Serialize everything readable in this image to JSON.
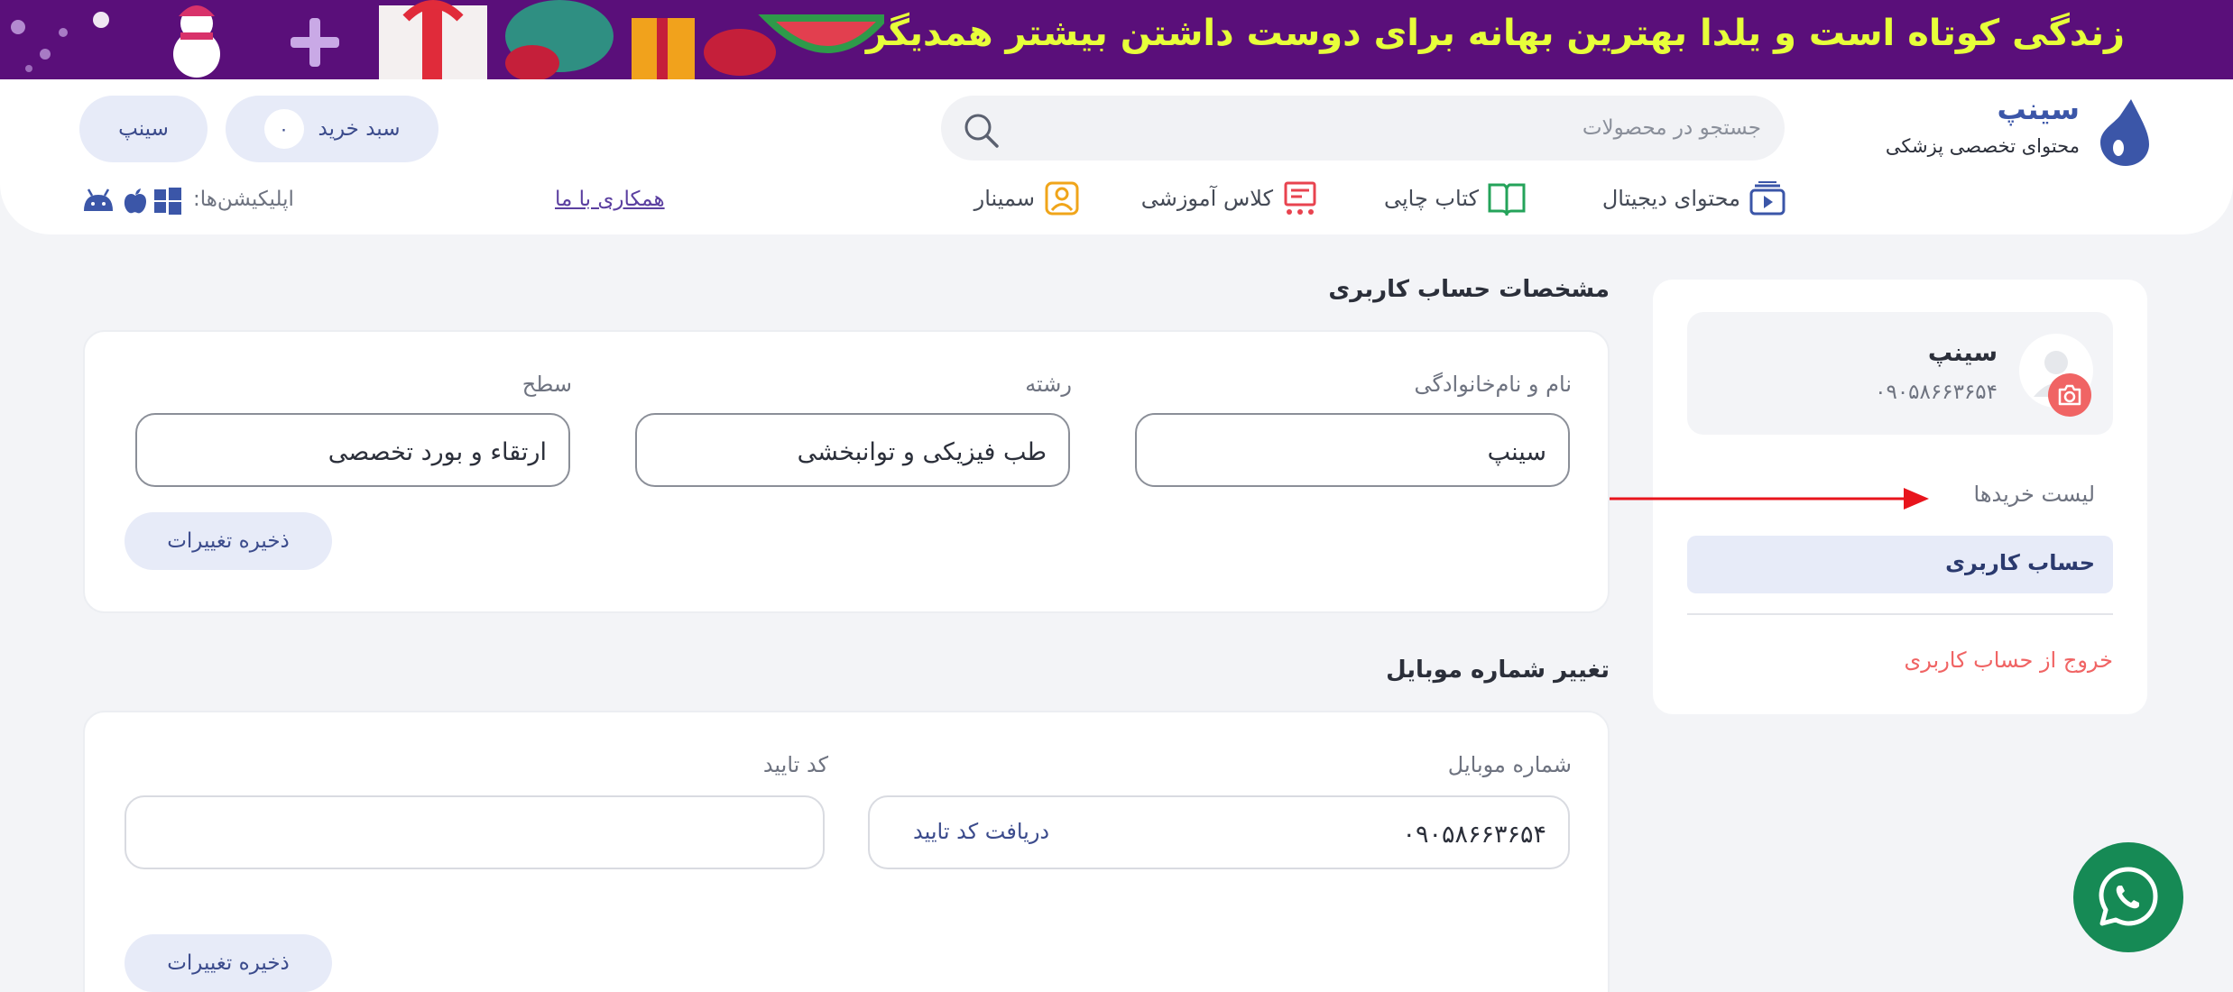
{
  "banner": {
    "text": "زندگی کوتاه است و یلدا بهترین بهانه برای دوست داشتن بیشتر همدیگر"
  },
  "header": {
    "brand_name": "سینپ",
    "brand_subtitle": "محتوای تخصصی پزشکی",
    "search_placeholder": "جستجو در محصولات",
    "cart_label": "سبد خرید",
    "cart_count": "۰",
    "user_label": "سینپ",
    "nav": [
      {
        "label": "محتوای دیجیتال",
        "icon": "digital-content-icon"
      },
      {
        "label": "کتاب چاپی",
        "icon": "book-icon"
      },
      {
        "label": "کلاس آموزشی",
        "icon": "class-icon"
      },
      {
        "label": "سمینار",
        "icon": "seminar-icon"
      }
    ],
    "cooperate_link": "همکاری با ما",
    "apps_label": "اپلیکیشن‌ها:",
    "app_icons": [
      "windows-icon",
      "apple-icon",
      "android-icon"
    ]
  },
  "sidebar": {
    "profile_name": "سینپ",
    "profile_phone": "۰۹۰۵۸۶۶۳۶۵۴",
    "purchases_link": "لیست خریدها",
    "account_link": "حساب کاربری",
    "logout_link": "خروج از حساب کاربری"
  },
  "account": {
    "title": "مشخصات حساب کاربری",
    "name_label": "نام و نام‌خانوادگی",
    "name_value": "سینپ",
    "field_label": "رشته",
    "field_value": "طب فیزیکی و توانبخشی",
    "level_label": "سطح",
    "level_value": "ارتقاء و بورد تخصصی",
    "save_label": "ذخیره تغییرات"
  },
  "mobile": {
    "title": "تغییر شماره موبایل",
    "phone_label": "شماره موبایل",
    "phone_value": "۰۹۰۵۸۶۶۳۶۵۴",
    "get_code_label": "دریافت کد تایید",
    "code_label": "کد تایید",
    "code_value": "",
    "save_label": "ذخیره تغییرات"
  },
  "colors": {
    "banner_bg": "#5a0f7a",
    "banner_text": "#e7ff3a",
    "brand_blue": "#3b56a8",
    "pill_bg": "#e7ebf8",
    "danger": "#f06464",
    "whatsapp": "#168a55",
    "annotation_arrow": "#e8141c"
  }
}
